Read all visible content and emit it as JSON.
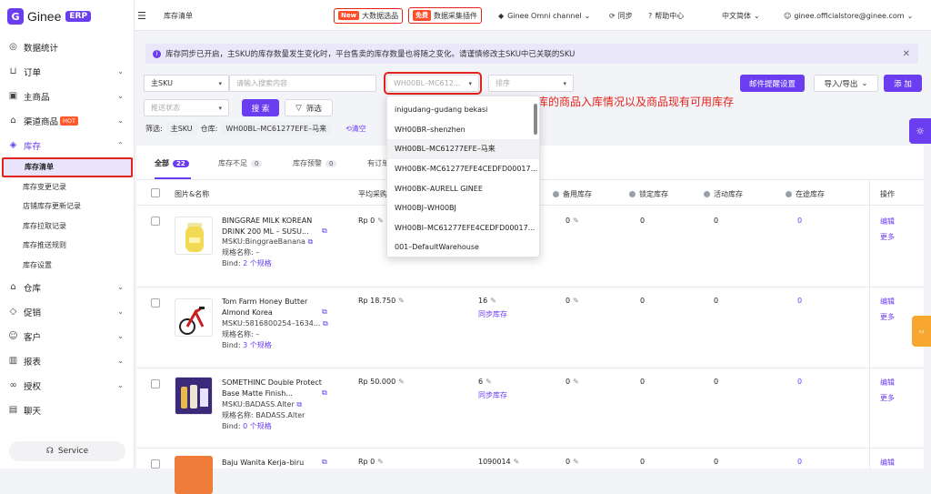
{
  "app": {
    "logo_text": "Ginee",
    "logo_tag": "ERP"
  },
  "sidebar": {
    "items": [
      {
        "label": "数据统计",
        "icon": "dashboard-icon"
      },
      {
        "label": "订单",
        "icon": "cart-icon"
      },
      {
        "label": "主商品",
        "icon": "box-icon"
      },
      {
        "label": "渠道商品",
        "icon": "store-icon",
        "badge": "HOT"
      },
      {
        "label": "库存",
        "icon": "inventory-icon"
      }
    ],
    "inventory_sub": [
      "库存清单",
      "库存变更记录",
      "店铺库存更新记录",
      "库存拉取记录",
      "库存推送规则",
      "库存设置"
    ],
    "items_after": [
      {
        "label": "仓库",
        "icon": "warehouse-icon"
      },
      {
        "label": "促销",
        "icon": "tag-icon"
      },
      {
        "label": "客户",
        "icon": "users-icon"
      },
      {
        "label": "报表",
        "icon": "chart-icon"
      },
      {
        "label": "授权",
        "icon": "link-icon"
      },
      {
        "label": "聊天",
        "icon": "chat-icon"
      }
    ],
    "service": "Service"
  },
  "topbar": {
    "page_title": "库存清单",
    "bigdata_badge": "New",
    "bigdata_label": "大数据选品",
    "plugin_badge": "免费",
    "plugin_label": "数据采集插件",
    "omni": "Ginee Omni channel",
    "sync": "同步",
    "help": "帮助中心",
    "lang": "中文简体",
    "email": "ginee.officialstore@ginee.com"
  },
  "notice": "库存同步已开启，主SKU的库存数量发生变化时，平台售卖的库存数量也将随之变化。请谨慎修改主SKU中已关联的SKU",
  "filters": {
    "sku_type": "主SKU",
    "search_placeholder": "请输入搜索内容",
    "warehouse_value": "WH00BL–MC612...",
    "sort_placeholder": "排序",
    "push_placeholder": "推送状态",
    "search_btn": "搜 索",
    "filter_btn": "筛选",
    "mail_btn": "邮件提醒设置",
    "import_btn": "导入/导出",
    "add_btn": "添 加",
    "filter_prefix": "筛选:",
    "chip1": "主SKU",
    "wh_prefix": "仓库:",
    "chip2": "WH00BL–MC61277EFE–马来",
    "clear": "清空"
  },
  "annotation": "查看每个仓库的商品入库情况以及商品现有可用库存",
  "tabs": [
    {
      "label": "全部",
      "count": "22"
    },
    {
      "label": "库存不足",
      "count": "0"
    },
    {
      "label": "库存预警",
      "count": "0"
    },
    {
      "label": "有订单"
    }
  ],
  "columns": {
    "product": "图片&名称",
    "cost": "平均采购",
    "spare": "备用库存",
    "locked": "锁定库存",
    "promo": "活动库存",
    "transit": "在途库存",
    "ops": "操作"
  },
  "rows": [
    {
      "name": "BINGGRAE MILK KOREAN DRINK 200 ML – SUSU...",
      "msku": "MSKU:BinggraeBanana",
      "spec": "规格名称: –",
      "bind_prefix": "Bind: ",
      "bind_link": "2 个规格",
      "cost": "Rp 0",
      "stock": "",
      "sync": "",
      "spare": "0",
      "locked": "0",
      "promo": "0",
      "transit": "0",
      "edit": "编辑",
      "more": "更多"
    },
    {
      "name": "Tom Farm Honey Butter Almond Korea",
      "msku": "MSKU:5816800254–1634...",
      "spec": "规格名称: –",
      "bind_prefix": "Bind: ",
      "bind_link": "3 个规格",
      "cost": "Rp 18.750",
      "stock": "16",
      "sync": "同步库存",
      "spare": "0",
      "locked": "0",
      "promo": "0",
      "transit": "0",
      "edit": "编辑",
      "more": "更多"
    },
    {
      "name": "SOMETHINC Double Protect Base Matte Finish...",
      "msku": "MSKU:BADASS.Alter",
      "spec": "规格名称: BADASS.Alter",
      "bind_prefix": "Bind: ",
      "bind_link": "0 个规格",
      "cost": "Rp 50.000",
      "stock": "6",
      "sync": "同步库存",
      "spare": "0",
      "locked": "0",
      "promo": "0",
      "transit": "0",
      "edit": "编辑",
      "more": "更多"
    },
    {
      "name": "Baju Wanita Kerja–biru",
      "cost": "Rp 0",
      "stock": "1090014",
      "spare": "0",
      "locked": "0",
      "promo": "0",
      "transit": "0",
      "edit": "编辑"
    }
  ],
  "dropdown": [
    "inigudang–gudang bekasi",
    "WH00BR–shenzhen",
    "WH00BL–MC61277EFE–马来",
    "WH00BK–MC61277EFE4CEDFD00017...",
    "WH00BK–AURELL GINEE",
    "WH00BJ–WH00BJ",
    "WH00BI–MC61277EFE4CEDFD00017...",
    "001–DefaultWarehouse"
  ],
  "colors": {
    "accent": "#6a3df0",
    "highlight": "#e2231a",
    "hot": "#ff5a2c"
  }
}
